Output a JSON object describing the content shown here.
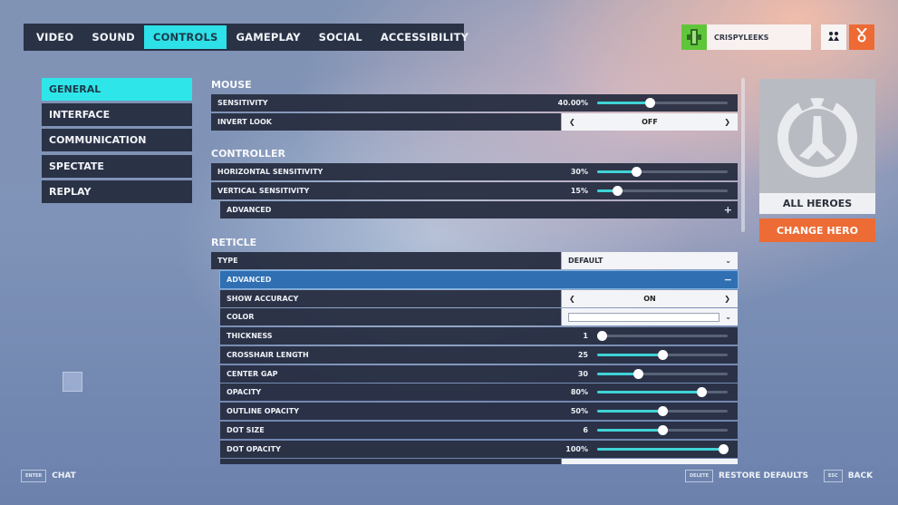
{
  "top_tabs": [
    {
      "label": "VIDEO",
      "active": false
    },
    {
      "label": "SOUND",
      "active": false
    },
    {
      "label": "CONTROLS",
      "active": true
    },
    {
      "label": "GAMEPLAY",
      "active": false
    },
    {
      "label": "SOCIAL",
      "active": false
    },
    {
      "label": "ACCESSIBILITY",
      "active": false
    }
  ],
  "profile": {
    "username": "CRISPYLEEKS",
    "avatar_icon": "player-icon",
    "social_icon": "group-icon",
    "reward_icon": "medal-icon",
    "accent_color": "#ee6a34",
    "avatar_color": "#5fc63a"
  },
  "side_nav": [
    {
      "label": "GENERAL",
      "active": true
    },
    {
      "label": "INTERFACE",
      "active": false
    },
    {
      "label": "COMMUNICATION",
      "active": false
    },
    {
      "label": "SPECTATE",
      "active": false
    },
    {
      "label": "REPLAY",
      "active": false
    }
  ],
  "mouse": {
    "title": "MOUSE",
    "sensitivity": {
      "label": "SENSITIVITY",
      "value": "40.00%",
      "fraction": 0.4
    },
    "invert_look": {
      "label": "INVERT LOOK",
      "value": "OFF"
    }
  },
  "controller": {
    "title": "CONTROLLER",
    "horizontal": {
      "label": "HORIZONTAL SENSITIVITY",
      "value": "30%",
      "fraction": 0.3
    },
    "vertical": {
      "label": "VERTICAL SENSITIVITY",
      "value": "15%",
      "fraction": 0.15
    },
    "advanced": {
      "label": "ADVANCED",
      "state": "+"
    }
  },
  "reticle": {
    "title": "RETICLE",
    "type": {
      "label": "TYPE",
      "value": "DEFAULT"
    },
    "advanced": {
      "label": "ADVANCED",
      "state": "−"
    },
    "show_accuracy": {
      "label": "SHOW ACCURACY",
      "value": "ON"
    },
    "color": {
      "label": "COLOR",
      "value_color": "#ffffff"
    },
    "sliders": [
      {
        "label": "THICKNESS",
        "value": "1",
        "fraction": 0.0
      },
      {
        "label": "CROSSHAIR LENGTH",
        "value": "25",
        "fraction": 0.5
      },
      {
        "label": "CENTER GAP",
        "value": "30",
        "fraction": 0.31
      },
      {
        "label": "OPACITY",
        "value": "80%",
        "fraction": 0.8
      },
      {
        "label": "OUTLINE OPACITY",
        "value": "50%",
        "fraction": 0.5
      },
      {
        "label": "DOT SIZE",
        "value": "6",
        "fraction": 0.5
      },
      {
        "label": "DOT OPACITY",
        "value": "100%",
        "fraction": 1.0
      }
    ]
  },
  "hero": {
    "name": "ALL HEROES",
    "change_label": "CHANGE HERO"
  },
  "footer": {
    "chat": {
      "key": "ENTER",
      "label": "CHAT"
    },
    "restore": {
      "key": "DELETE",
      "label": "RESTORE DEFAULTS"
    },
    "back": {
      "key": "ESC",
      "label": "BACK"
    }
  }
}
